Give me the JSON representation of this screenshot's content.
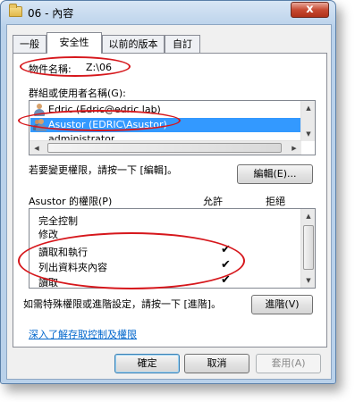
{
  "window": {
    "title": "06 - 內容",
    "close_label": "x"
  },
  "tabs": [
    {
      "label": "一般"
    },
    {
      "label": "安全性"
    },
    {
      "label": "以前的版本"
    },
    {
      "label": "自訂"
    }
  ],
  "object": {
    "label": "物件名稱:",
    "value": "Z:\\06"
  },
  "users": {
    "label": "群組或使用者名稱(G):",
    "items": [
      {
        "name": "Edric (Edric@edric.lab)"
      },
      {
        "name": "Asustor (EDRIC\\Asustor)"
      },
      {
        "name": "administrator"
      }
    ],
    "selected_index": 1
  },
  "edit": {
    "hint": "若要變更權限，請按一下 [編輯]。",
    "button_label": "編輯(E)..."
  },
  "permissions": {
    "label": "Asustor 的權限(P)",
    "allow_header": "允許",
    "deny_header": "拒絕",
    "rows": [
      {
        "name": "完全控制",
        "allow": false,
        "deny": false
      },
      {
        "name": "修改",
        "allow": false,
        "deny": false
      },
      {
        "name": "讀取和執行",
        "allow": true,
        "deny": false
      },
      {
        "name": "列出資料夾內容",
        "allow": true,
        "deny": false
      },
      {
        "name": "讀取",
        "allow": true,
        "deny": false
      }
    ],
    "check_glyph": "✔"
  },
  "advanced": {
    "hint": "如需特殊權限或進階設定，請按一下 [進階]。",
    "button_label": "進階(V)"
  },
  "learn_link": "深入了解存取控制及權限",
  "footer": {
    "ok_label": "確定",
    "cancel_label": "取消",
    "apply_label": "套用(A)"
  },
  "accent_colors": {
    "selection": "#3399ff",
    "highlight_ellipse": "#d6171c",
    "link": "#0066cc"
  }
}
